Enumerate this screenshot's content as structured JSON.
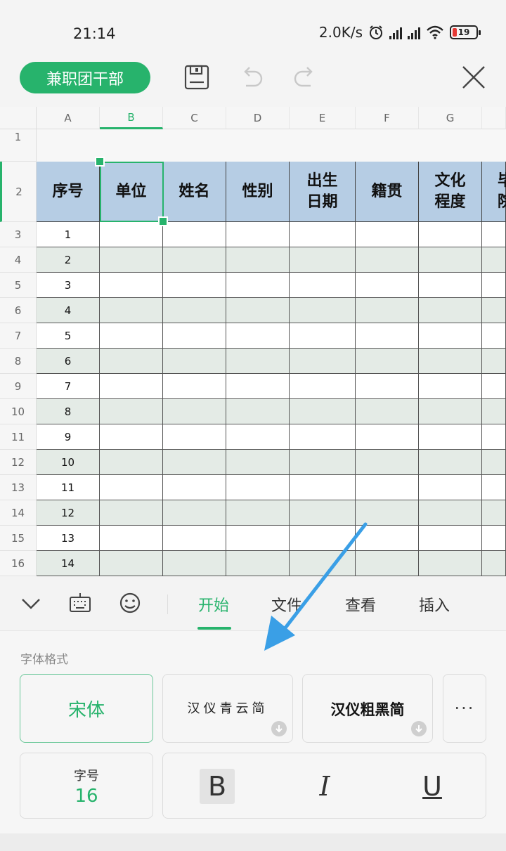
{
  "status": {
    "time": "21:14",
    "net_speed": "2.0K/s",
    "battery": "19"
  },
  "toolbar": {
    "doc_title": "兼职团干部"
  },
  "sheet": {
    "columns": [
      "A",
      "B",
      "C",
      "D",
      "E",
      "F",
      "G"
    ],
    "row_numbers": [
      "1",
      "2",
      "3",
      "4",
      "5",
      "6",
      "7",
      "8",
      "9",
      "10",
      "11",
      "12",
      "13",
      "14",
      "15",
      "16"
    ],
    "header_cells": [
      "序号",
      "单位",
      "姓名",
      "性别",
      "出生\n日期",
      "籍贯",
      "文化\n程度",
      "毕\n院"
    ],
    "serials": [
      "1",
      "2",
      "3",
      "4",
      "5",
      "6",
      "7",
      "8",
      "9",
      "10",
      "11",
      "12",
      "13",
      "14"
    ],
    "selected_cell": "B2"
  },
  "tabs": {
    "items": [
      "开始",
      "文件",
      "查看",
      "插入"
    ],
    "active": "开始"
  },
  "font_panel": {
    "section_label": "字体格式",
    "fonts": [
      "宋体",
      "汉仪青云简",
      "汉仪粗黑简"
    ],
    "more": "···",
    "size_label": "字号",
    "size_value": "16",
    "bold": "B",
    "italic": "I",
    "underline": "U"
  },
  "colors": {
    "accent": "#27b36c",
    "header_fill": "#b6cde4",
    "band_fill": "#e4ebe6",
    "arrow": "#3a9fe6"
  }
}
